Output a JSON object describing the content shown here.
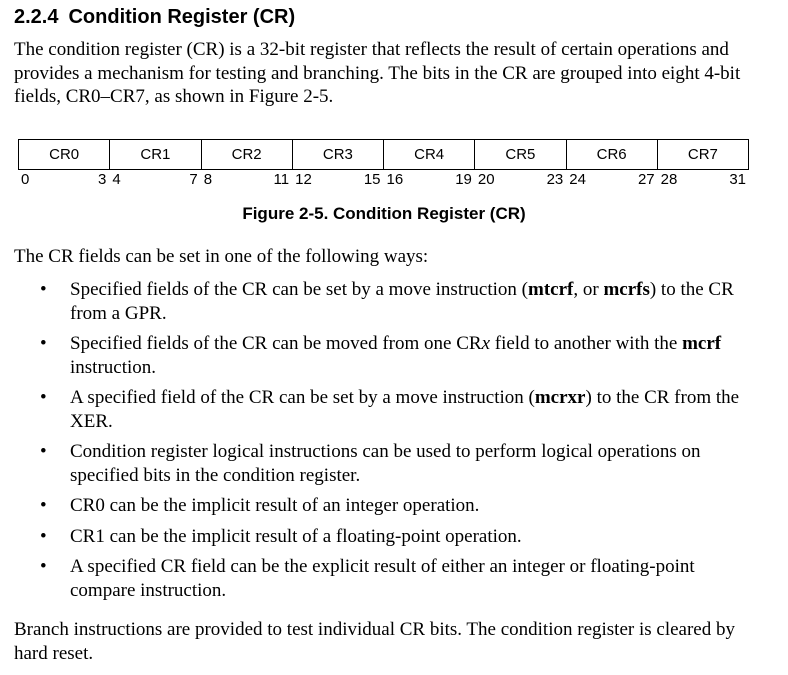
{
  "section": {
    "number": "2.2.4",
    "title": "Condition Register (CR)"
  },
  "intro": "The condition register (CR) is a 32-bit register that reflects the result of certain operations and provides a mechanism for testing and branching. The bits in the CR are grouped into eight 4-bit fields, CR0–CR7, as shown in Figure 2-5.",
  "figure": {
    "fields": [
      "CR0",
      "CR1",
      "CR2",
      "CR3",
      "CR4",
      "CR5",
      "CR6",
      "CR7"
    ],
    "bit_numbers": [
      {
        "start": "0",
        "end": "3"
      },
      {
        "start": "4",
        "end": "7"
      },
      {
        "start": "8",
        "end": "11"
      },
      {
        "start": "12",
        "end": "15"
      },
      {
        "start": "16",
        "end": "19"
      },
      {
        "start": "20",
        "end": "23"
      },
      {
        "start": "24",
        "end": "27"
      },
      {
        "start": "28",
        "end": "31"
      }
    ],
    "caption": "Figure 2-5. Condition Register (CR)"
  },
  "lead": "The CR fields can be set in one of the following ways:",
  "bullets": [
    {
      "parts": [
        {
          "t": "Specified fields of the CR can be set by a move instruction ("
        },
        {
          "t": "mtcrf",
          "b": true
        },
        {
          "t": ", or "
        },
        {
          "t": "mcrfs",
          "b": true
        },
        {
          "t": ") to the CR from a GPR."
        }
      ]
    },
    {
      "parts": [
        {
          "t": "Specified fields of the CR can be moved from one CR"
        },
        {
          "t": "x",
          "i": true
        },
        {
          "t": " field to another with the "
        },
        {
          "t": "mcrf",
          "b": true
        },
        {
          "t": " instruction."
        }
      ]
    },
    {
      "parts": [
        {
          "t": "A specified field of the CR can be set by a move instruction ("
        },
        {
          "t": "mcrxr",
          "b": true
        },
        {
          "t": ") to the CR from the XER."
        }
      ]
    },
    {
      "parts": [
        {
          "t": "Condition register logical instructions can be used to perform logical operations on specified bits in the condition register."
        }
      ]
    },
    {
      "parts": [
        {
          "t": "CR0 can be the implicit result of an integer operation."
        }
      ]
    },
    {
      "parts": [
        {
          "t": "CR1 can be the implicit result of a floating-point operation."
        }
      ]
    },
    {
      "parts": [
        {
          "t": "A specified CR field can be the explicit result of either an integer or floating-point compare instruction."
        }
      ]
    }
  ],
  "bullet_glyph": "•",
  "closing": "Branch instructions are provided to test individual CR bits. The condition register is cleared by hard reset."
}
